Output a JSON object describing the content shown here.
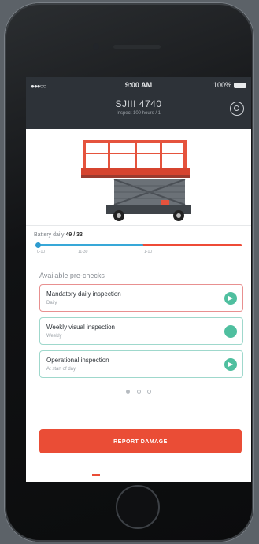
{
  "status_bar": {
    "signal": "●●●○○",
    "time": "9:00 AM",
    "battery": "100%"
  },
  "header": {
    "title": "SJIII 4740",
    "subtitle": "Inspect 100 hours / 1",
    "settings_icon": "gear-icon"
  },
  "battery": {
    "label": "Battery daily",
    "value": "49 / 33",
    "level": 0.52,
    "ticks": [
      "0-10",
      "11-30",
      "1-10"
    ]
  },
  "prechecks": {
    "title": "Available pre-checks",
    "items": [
      {
        "title": "Mandatory daily inspection",
        "subtitle": "Daily",
        "style": "red"
      },
      {
        "title": "Weekly visual inspection",
        "subtitle": "Weekly",
        "style": "teal"
      },
      {
        "title": "Operational inspection",
        "subtitle": "At start of day",
        "style": "teal"
      }
    ]
  },
  "pagination": {
    "pages": 3,
    "active": 0
  },
  "actions": {
    "report_label": "REPORT DAMAGE"
  },
  "colors": {
    "accent": "#ea4d36",
    "teal": "#4fbf9f",
    "header": "#2d3238",
    "battery_blue": "#38a8d8"
  }
}
